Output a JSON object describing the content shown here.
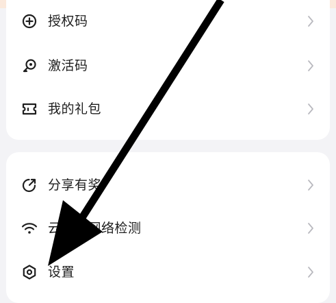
{
  "menu_group_1": {
    "items": [
      {
        "label": "授权码",
        "icon": "plus-circle-icon"
      },
      {
        "label": "激活码",
        "icon": "key-icon"
      },
      {
        "label": "我的礼包",
        "icon": "ticket-icon"
      }
    ]
  },
  "menu_group_2": {
    "items": [
      {
        "label": "分享有奖",
        "icon": "share-external-icon"
      },
      {
        "label": "云手机网络检测",
        "icon": "wifi-icon"
      },
      {
        "label": "设置",
        "icon": "settings-hexagon-icon"
      }
    ]
  },
  "annotation": {
    "type": "arrow",
    "color": "#000000",
    "points_to": "设置"
  },
  "colors": {
    "background": "#f3f3f6",
    "card": "#ffffff",
    "chevron": "#b9b9bf",
    "top_strip": "#fbe9dc"
  }
}
